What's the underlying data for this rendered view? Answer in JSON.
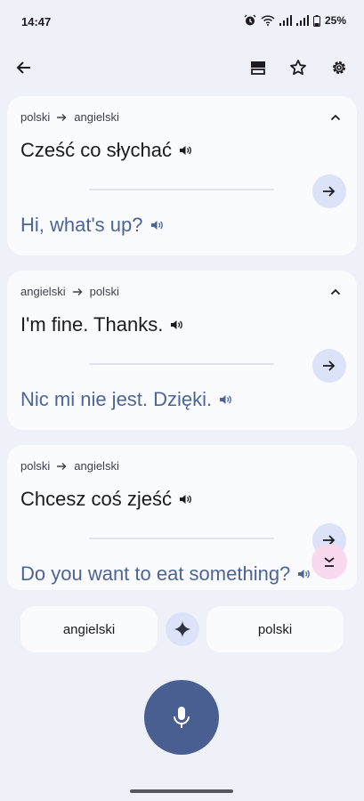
{
  "status_bar": {
    "time": "14:47",
    "battery": "25%"
  },
  "toolbar": {
    "back_icon": "arrow-left-icon",
    "saved_view_icon": "stacked-cards-icon",
    "favorite_icon": "star-outline-icon",
    "settings_icon": "gear-icon"
  },
  "conversation": [
    {
      "source_lang": "polski",
      "target_lang": "angielski",
      "source_text": "Cześć co słychać",
      "target_text": "Hi, what's up?"
    },
    {
      "source_lang": "angielski",
      "target_lang": "polski",
      "source_text": "I'm fine. Thanks.",
      "target_text": "Nic mi nie jest. Dzięki."
    },
    {
      "source_lang": "polski",
      "target_lang": "angielski",
      "source_text": "Chcesz coś zjeść",
      "target_text": "Do you want to eat something?"
    }
  ],
  "bottom": {
    "left_language": "angielski",
    "right_language": "polski",
    "auto_detect_icon": "sparkle-icon",
    "mic_icon": "microphone-icon"
  },
  "colors": {
    "background": "#eef1f8",
    "card": "#fafbff",
    "translation_text": "#4d6496",
    "mic_button": "#495f91",
    "swap_button": "#dce2f7",
    "scroll_button": "#f8d9ee"
  }
}
